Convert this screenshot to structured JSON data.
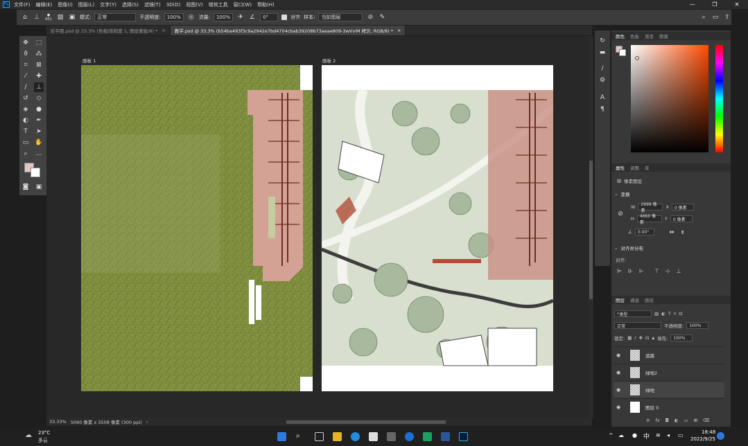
{
  "menu": {
    "logo": "Ps",
    "items": [
      "文件(F)",
      "编辑(E)",
      "图像(I)",
      "图层(L)",
      "文字(Y)",
      "选择(S)",
      "滤镜(T)",
      "3D(D)",
      "视图(V)",
      "增效工具",
      "窗口(W)",
      "帮助(H)"
    ]
  },
  "options": {
    "brush_size": "601",
    "mode_label": "模式:",
    "mode_value": "正常",
    "opacity_label": "不透明度:",
    "opacity_value": "100%",
    "flow_label": "流量:",
    "flow_value": "100%",
    "angle_value": "0°",
    "align_label": "对齐",
    "sample_label": "样本:",
    "sample_value": "当前图层"
  },
  "tabs": [
    {
      "label": "彩平图.psd @ 33.3% (色相/饱和度 1, 图层蒙版/8) *"
    },
    {
      "label": "教学.psd @ 33.3% (b54ba493f3c9a2942e7bd4704cbab39208b73aeae809-3wVviM 拷贝, RGB/8) *"
    }
  ],
  "canvas": {
    "artboard1": "画板 1",
    "artboard2": "画板 2"
  },
  "status": {
    "zoom": "33.33%",
    "doc_info": "5060 像素 x 3508 像素 (300 ppi)"
  },
  "color_panel": {
    "tabs": [
      "颜色",
      "色板",
      "渐变",
      "图案"
    ]
  },
  "properties": {
    "tabs": [
      "属性",
      "调整",
      "库"
    ],
    "kind": "像素图层",
    "transform_title": "变换",
    "w_label": "W",
    "w_value": "2999 像素",
    "h_label": "H",
    "h_value": "4660 像素",
    "x_label": "X",
    "x_value": "0 像素",
    "y_label": "Y",
    "y_value": "0 像素",
    "angle_value": "0.00°",
    "align_title": "对齐并分布",
    "align_sub": "对齐:"
  },
  "layers": {
    "tabs": [
      "图层",
      "通道",
      "路径"
    ],
    "filter": "类型",
    "blend": "正常",
    "opacity_label": "不透明度:",
    "opacity_value": "100%",
    "lock_label": "锁定:",
    "fill_label": "填充:",
    "fill_value": "100%",
    "items": [
      {
        "name": "道路"
      },
      {
        "name": "绿地2"
      },
      {
        "name": "绿地"
      },
      {
        "name": "图层 0"
      }
    ]
  },
  "taskbar": {
    "temp": "23°C",
    "weather": "多云",
    "ime": "中",
    "time": "18:48",
    "date": "2022/9/25"
  }
}
